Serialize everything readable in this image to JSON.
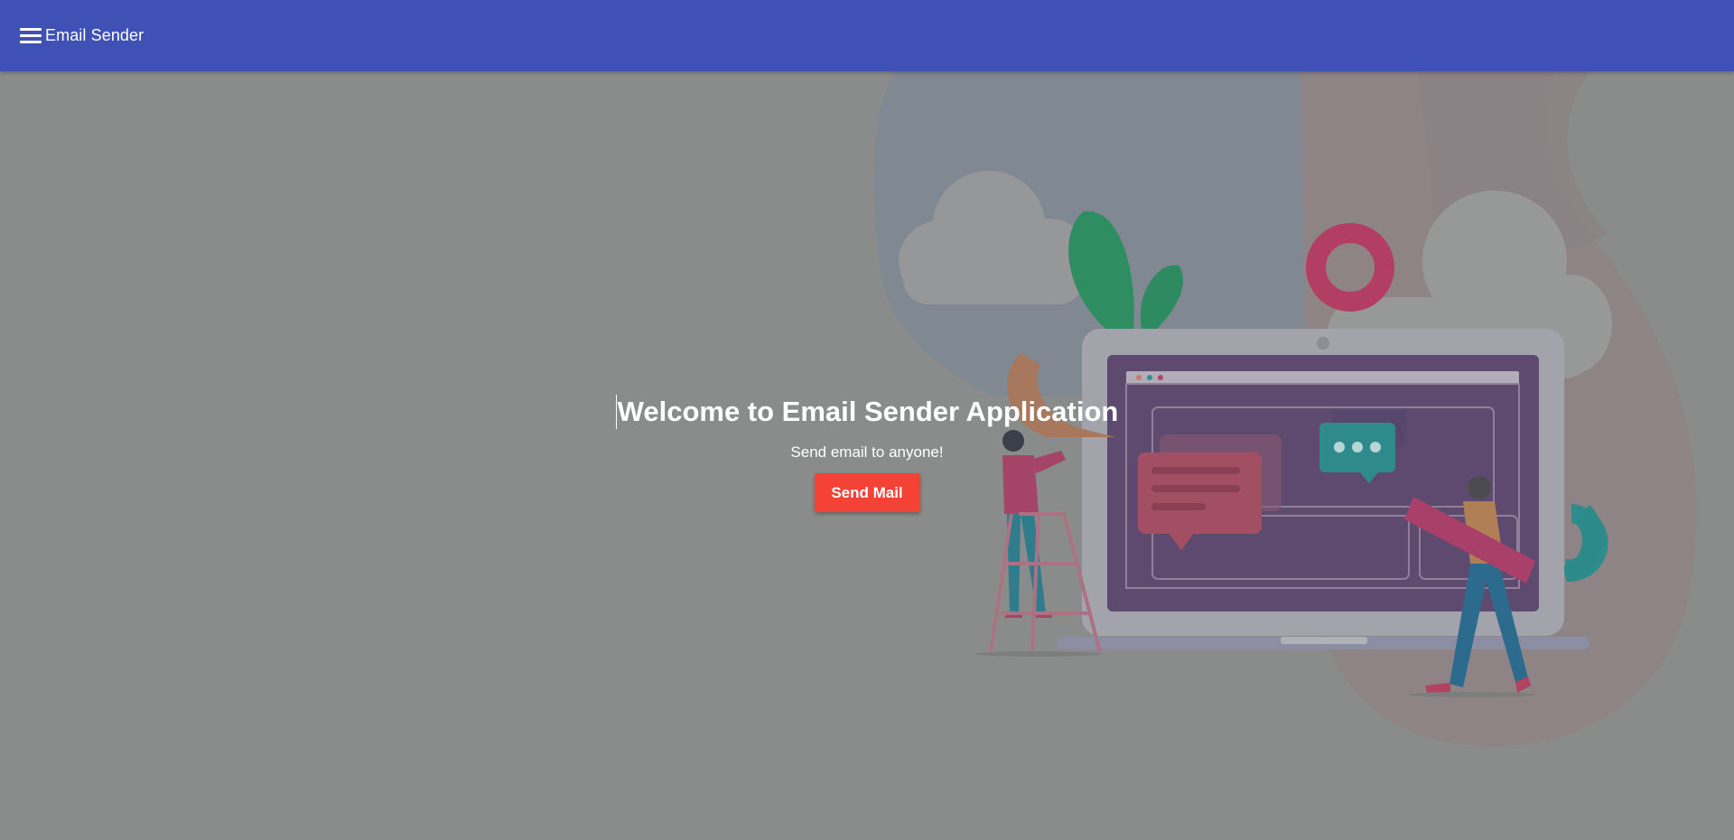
{
  "toolbar": {
    "menu_icon": "hamburger-menu-icon",
    "title": "Email Sender",
    "color": "#3f51b5"
  },
  "hero": {
    "title": "Welcome to Email Sender Application",
    "subtitle": "Send email to anyone!",
    "button_label": "Send Mail",
    "button_color": "#f44336"
  },
  "background": {
    "overlay_color": "#8a8c8b",
    "illustration": "people-building-website-on-laptop-illustration"
  }
}
